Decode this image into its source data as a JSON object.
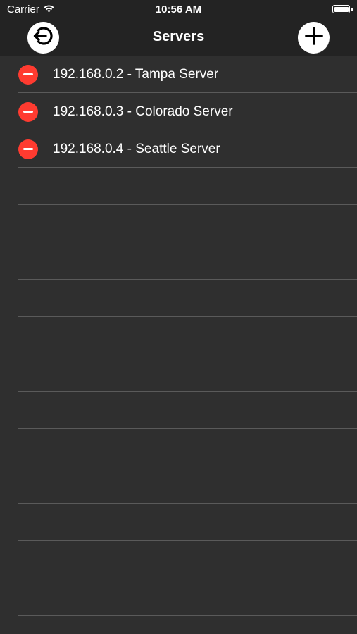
{
  "status_bar": {
    "carrier": "Carrier",
    "time": "10:56 AM"
  },
  "nav": {
    "title": "Servers",
    "left_icon": "logout-icon",
    "right_icon": "plus-icon"
  },
  "servers": [
    {
      "label": "192.168.0.2 - Tampa Server"
    },
    {
      "label": "192.168.0.3 - Colorado Server"
    },
    {
      "label": "192.168.0.4 - Seattle Server"
    }
  ],
  "colors": {
    "background": "#2f2f2f",
    "bar": "#232323",
    "delete": "#ff3b30",
    "separator": "#5a5a5a"
  }
}
